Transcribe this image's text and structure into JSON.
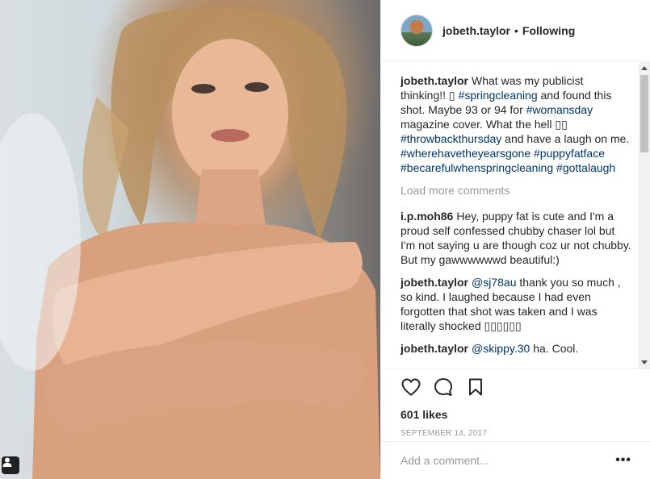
{
  "post": {
    "photo_alt": "Photo",
    "user_tag_icon": "person-icon"
  },
  "header": {
    "username": "jobeth.taylor",
    "separator": "•",
    "follow_status": "Following"
  },
  "caption": {
    "username": "jobeth.taylor",
    "text_parts": {
      "p1": "What was my publicist thinking!! ▯",
      "t1": "#springcleaning",
      "p2": " and found this shot. Maybe 93 or 94 for ",
      "t2": "#womansday",
      "p3": " magazine cover. What the hell ▯▯",
      "t3": "#throwbackthursday",
      "p4": " and have a laugh on me. ",
      "t4": "#wherehavetheyearsgone",
      "t5": "#puppyfatface",
      "t6": "#becarefulwhenspringcleaning",
      "t7": "#gottalaugh"
    }
  },
  "load_more": "Load more comments",
  "comments": [
    {
      "username": "i.p.moh86",
      "text": "Hey, puppy fat is cute and I'm a proud self confessed chubby chaser lol but I'm not saying u are though coz ur not chubby. But my gawwwwwwd beautiful:)"
    },
    {
      "username": "jobeth.taylor",
      "mention": "@sj78au",
      "text": " thank you so much , so kind. I laughed because I had even forgotten that shot was taken and I was literally shocked ▯▯▯▯▯▯"
    },
    {
      "username": "jobeth.taylor",
      "mention": "@skippy.30",
      "text": " ha. Cool."
    }
  ],
  "actions": {
    "like_icon": "heart-icon",
    "comment_icon": "comment-icon",
    "save_icon": "bookmark-icon"
  },
  "likes": "601 likes",
  "date": "SEPTEMBER 14, 2017",
  "add_comment": {
    "placeholder": "Add a comment...",
    "more_label": "•••"
  },
  "colors": {
    "hashtag": "#003569",
    "muted": "#999999",
    "text": "#262626",
    "border": "#efefef"
  }
}
